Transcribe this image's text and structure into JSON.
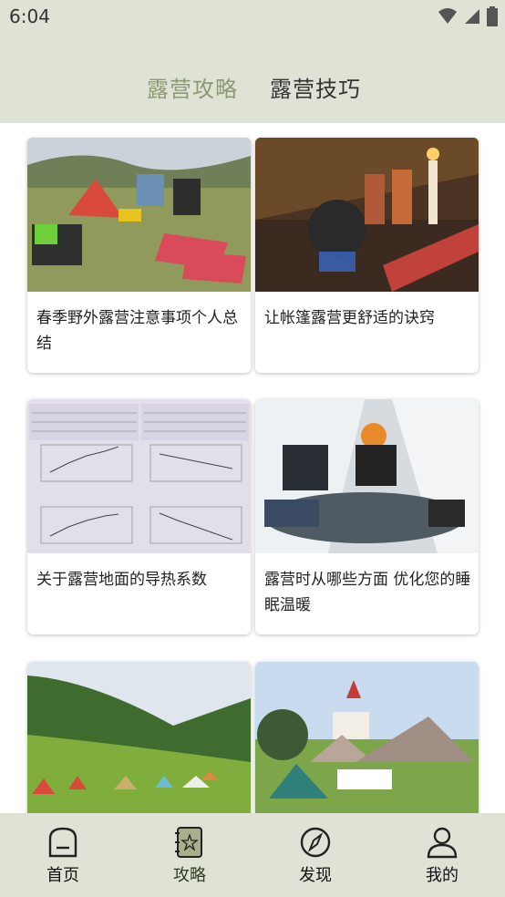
{
  "status": {
    "time": "6:04"
  },
  "tabs": [
    {
      "label": "露营攻略"
    },
    {
      "label": "露营技巧"
    }
  ],
  "cards": [
    {
      "title": "春季野外露营注意事项个人总结"
    },
    {
      "title": "让帐篷露营更舒适的诀窍"
    },
    {
      "title": "关于露营地面的导热系数"
    },
    {
      "title": "露营时从哪些方面 优化您的睡眠温暖"
    },
    {
      "title": ""
    },
    {
      "title": ""
    }
  ],
  "nav": [
    {
      "label": "首页",
      "icon": "home-icon"
    },
    {
      "label": "攻略",
      "icon": "guide-icon"
    },
    {
      "label": "发现",
      "icon": "compass-icon"
    },
    {
      "label": "我的",
      "icon": "profile-icon"
    }
  ],
  "colors": {
    "header_bg": "#dfe3d6",
    "tab_active": "#8c9a73",
    "tab_inactive": "#333333"
  }
}
